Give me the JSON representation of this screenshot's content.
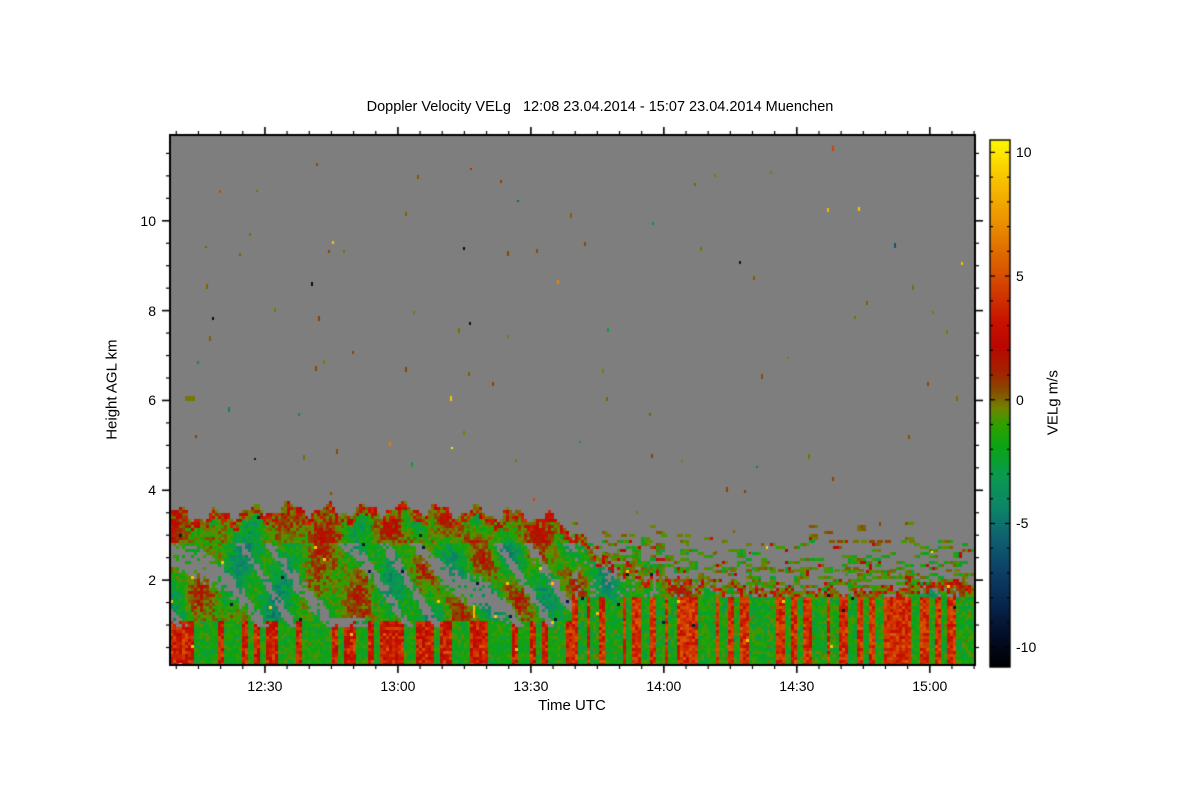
{
  "page": {
    "background": "#ffffff",
    "text_color": "#000000"
  },
  "chart_data": {
    "type": "heatmap",
    "title": "Doppler Velocity VELg   12:08 23.04.2014 - 15:07 23.04.2014 Muenchen",
    "product": "Doppler Velocity VELg",
    "time_start": "12:08 23.04.2014",
    "time_end": "15:07 23.04.2014",
    "station": "Muenchen",
    "xlabel": "Time UTC",
    "ylabel": "Height AGL km",
    "x_range_hours": [
      12.143,
      15.17
    ],
    "y_range_km": [
      0.11,
      11.91
    ],
    "x_ticks": [
      {
        "h": 12.5,
        "label": "12:30"
      },
      {
        "h": 13.0,
        "label": "13:00"
      },
      {
        "h": 13.5,
        "label": "13:30"
      },
      {
        "h": 14.0,
        "label": "14:00"
      },
      {
        "h": 14.5,
        "label": "14:30"
      },
      {
        "h": 15.0,
        "label": "15:00"
      }
    ],
    "x_minor_step_min": 5,
    "y_ticks": [
      {
        "value": 2,
        "label": "2"
      },
      {
        "value": 4,
        "label": "4"
      },
      {
        "value": 6,
        "label": "6"
      },
      {
        "value": 8,
        "label": "8"
      },
      {
        "value": 10,
        "label": "10"
      }
    ],
    "y_minor_step_km": 0.5,
    "no_data_color": "#7e7e7e",
    "frame_color": "#000000",
    "colorbar": {
      "label": "VELg m/s",
      "range": [
        -10.8,
        10.5
      ],
      "ticks": [
        {
          "value": 10,
          "label": "10"
        },
        {
          "value": 5,
          "label": "5"
        },
        {
          "value": 0,
          "label": "0"
        },
        {
          "value": -5,
          "label": "-5"
        },
        {
          "value": -10,
          "label": "-10"
        }
      ],
      "minor_step": 1,
      "stops": [
        [
          -10.8,
          "#000000"
        ],
        [
          -9.6,
          "#030d26"
        ],
        [
          -8.4,
          "#07234a"
        ],
        [
          -7.0,
          "#0c3f66"
        ],
        [
          -5.6,
          "#0f6070"
        ],
        [
          -4.4,
          "#0d8468"
        ],
        [
          -3.0,
          "#0a9b4e"
        ],
        [
          -1.9,
          "#0ba414"
        ],
        [
          -1.0,
          "#31a000"
        ],
        [
          -0.35,
          "#6f8400"
        ],
        [
          0.0,
          "#7c6700"
        ],
        [
          0.5,
          "#8c4400"
        ],
        [
          1.2,
          "#a42000"
        ],
        [
          2.2,
          "#bc0700"
        ],
        [
          3.2,
          "#c81400"
        ],
        [
          4.5,
          "#d23f00"
        ],
        [
          6.0,
          "#e06d00"
        ],
        [
          7.5,
          "#ee9b00"
        ],
        [
          9.0,
          "#f9c500"
        ],
        [
          10.0,
          "#fde800"
        ],
        [
          10.5,
          "#fdf802"
        ]
      ]
    },
    "features": {
      "seed": 7,
      "speckles": {
        "count": 115,
        "max_height_km": 11.7
      },
      "wave_amplitude_km": 0.13,
      "bl_profile": [
        [
          12.143,
          3.5
        ],
        [
          12.3,
          3.42
        ],
        [
          12.55,
          3.6
        ],
        [
          12.8,
          3.55
        ],
        [
          13.05,
          3.6
        ],
        [
          13.3,
          3.5
        ],
        [
          13.5,
          3.45
        ],
        [
          13.6,
          3.3
        ],
        [
          13.68,
          3.0
        ],
        [
          13.78,
          2.45
        ],
        [
          13.9,
          2.15
        ],
        [
          14.1,
          2.0
        ],
        [
          14.35,
          1.85
        ],
        [
          14.7,
          1.75
        ],
        [
          15.0,
          1.95
        ],
        [
          15.17,
          2.0
        ]
      ],
      "streaks": [
        {
          "km": 3.02,
          "t0": 13.72,
          "t1": 14.42,
          "density": 0.3
        },
        {
          "km": 2.6,
          "t0": 13.72,
          "t1": 14.15,
          "density": 0.25
        },
        {
          "km": 2.25,
          "t0": 14.22,
          "t1": 15.12,
          "density": 0.5
        },
        {
          "km": 2.3,
          "t0": 14.35,
          "t1": 14.75,
          "density": 0.35
        },
        {
          "km": 2.9,
          "t0": 14.5,
          "t1": 14.95,
          "density": 0.25
        }
      ],
      "blobs": [
        {
          "t": 12.22,
          "km": 6.05,
          "w": 10,
          "h": 5,
          "v": -0.2
        },
        {
          "t": 13.285,
          "km": 1.3,
          "w": 2,
          "h": 13,
          "v": 8.5
        }
      ]
    }
  }
}
